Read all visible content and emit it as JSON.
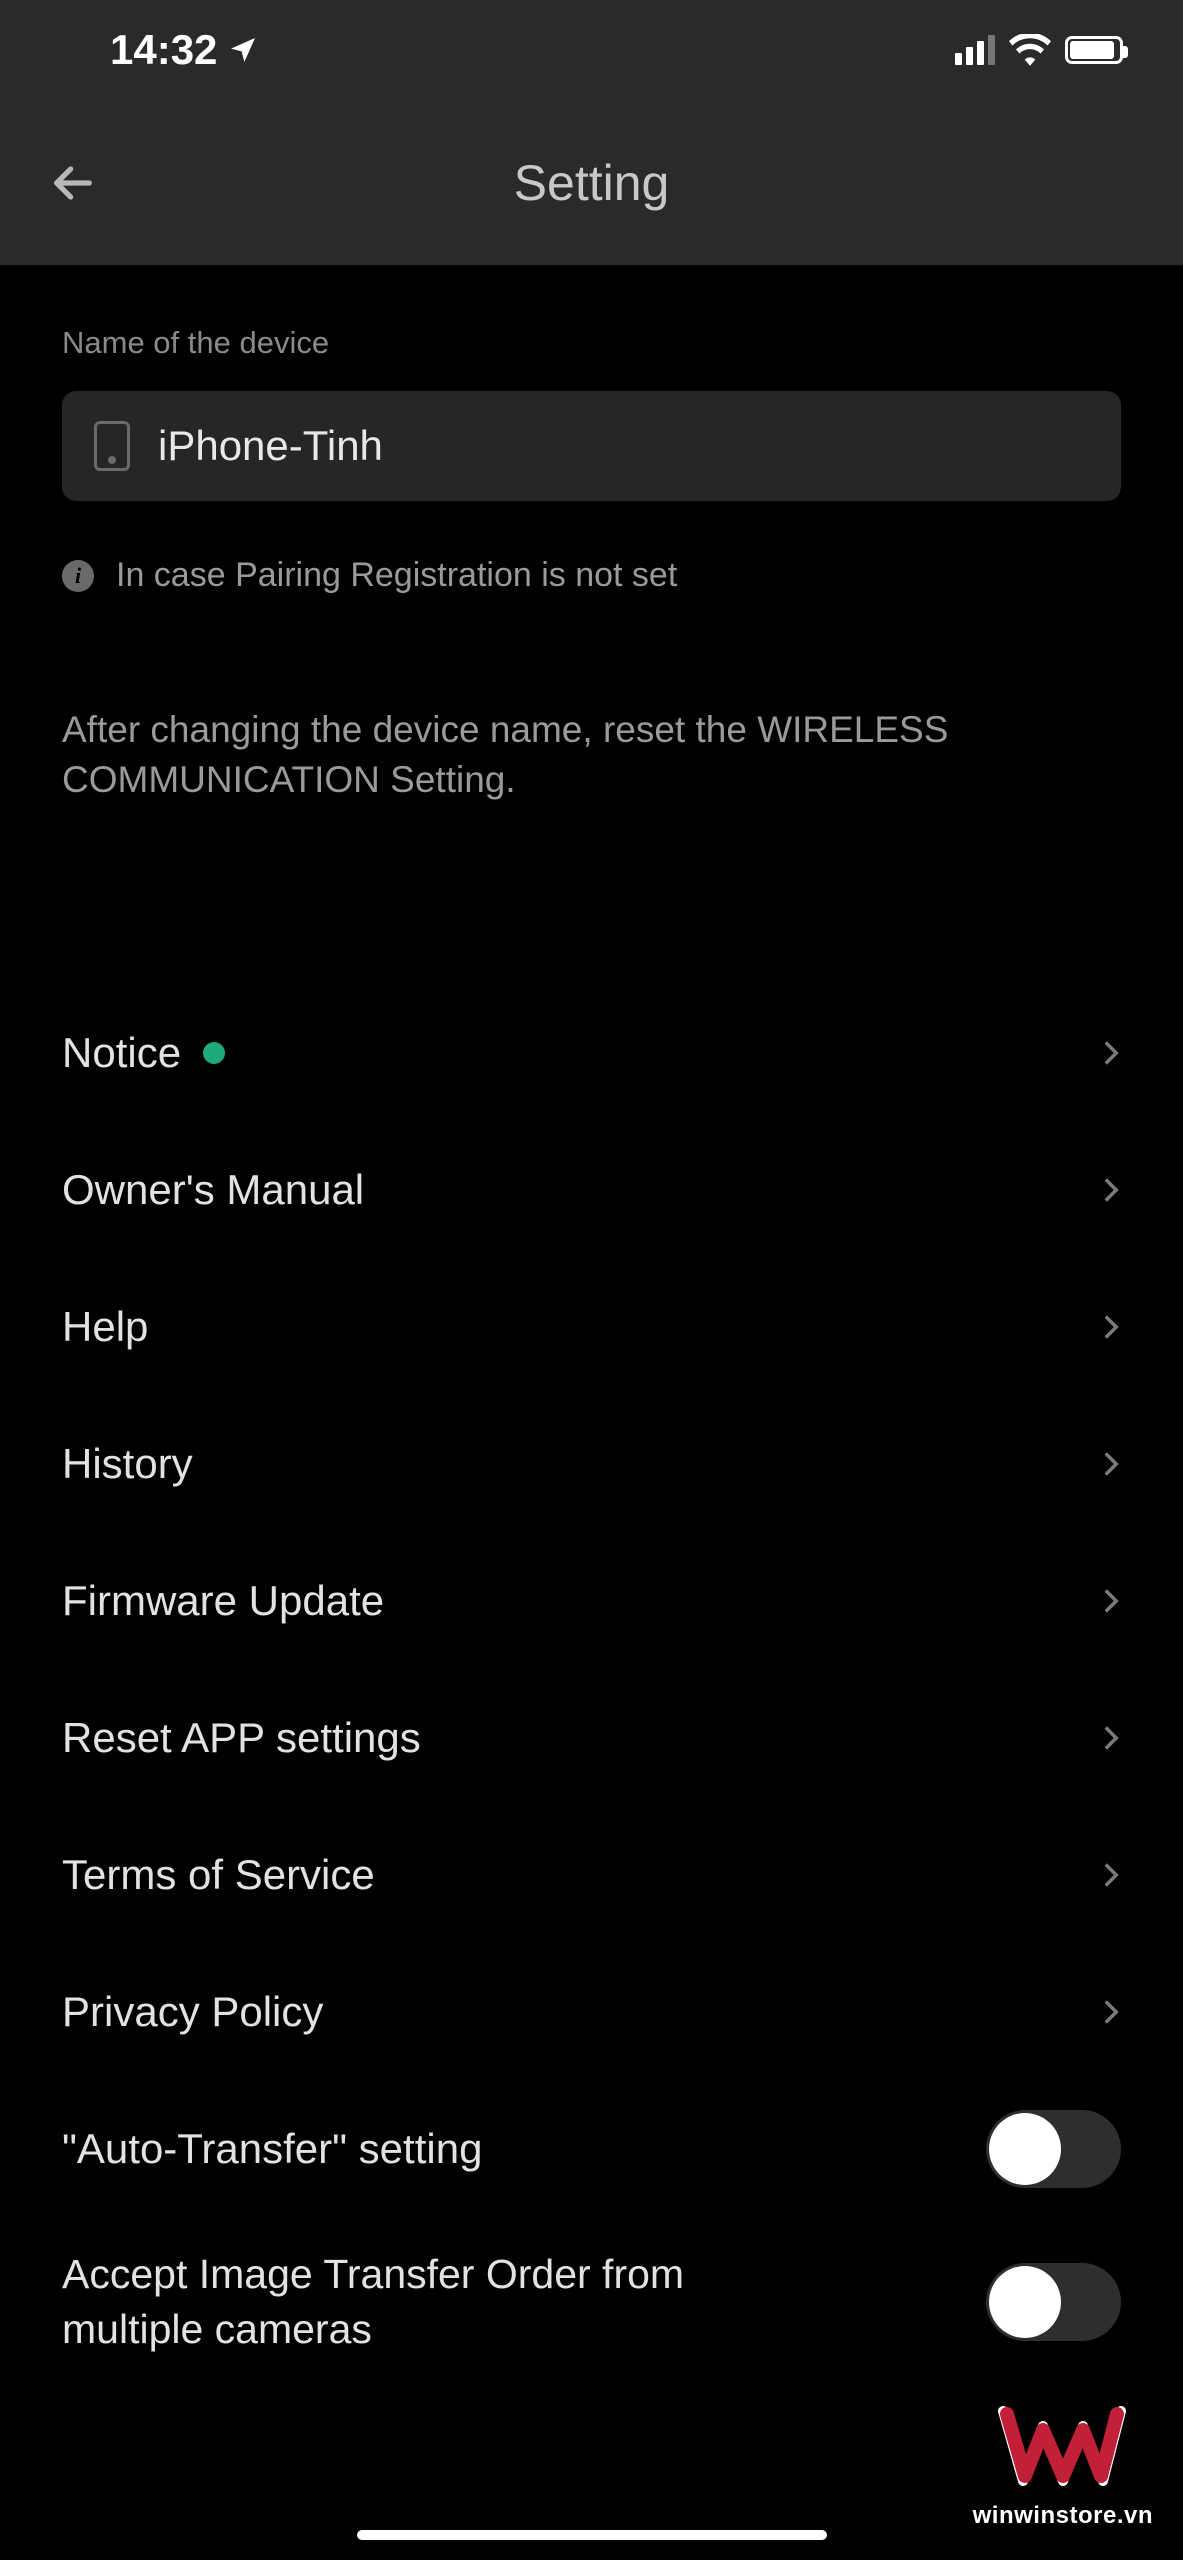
{
  "status": {
    "time": "14:32"
  },
  "header": {
    "title": "Setting"
  },
  "device": {
    "section_label": "Name of the device",
    "name": "iPhone-Tinh",
    "info": "In case Pairing Registration is not set",
    "note": "After changing the device name, reset the WIRELESS COMMUNICATION Setting."
  },
  "menu": {
    "notice": "Notice",
    "owners_manual": "Owner's Manual",
    "help": "Help",
    "history": "History",
    "firmware_update": "Firmware Update",
    "reset_app": "Reset APP settings",
    "terms": "Terms of Service",
    "privacy": "Privacy Policy",
    "auto_transfer": "\"Auto-Transfer\" setting",
    "accept_multi": "Accept Image Transfer Order from multiple cameras"
  },
  "toggles": {
    "auto_transfer": false,
    "accept_multi": false
  },
  "watermark": {
    "text": "winwinstore.vn"
  }
}
